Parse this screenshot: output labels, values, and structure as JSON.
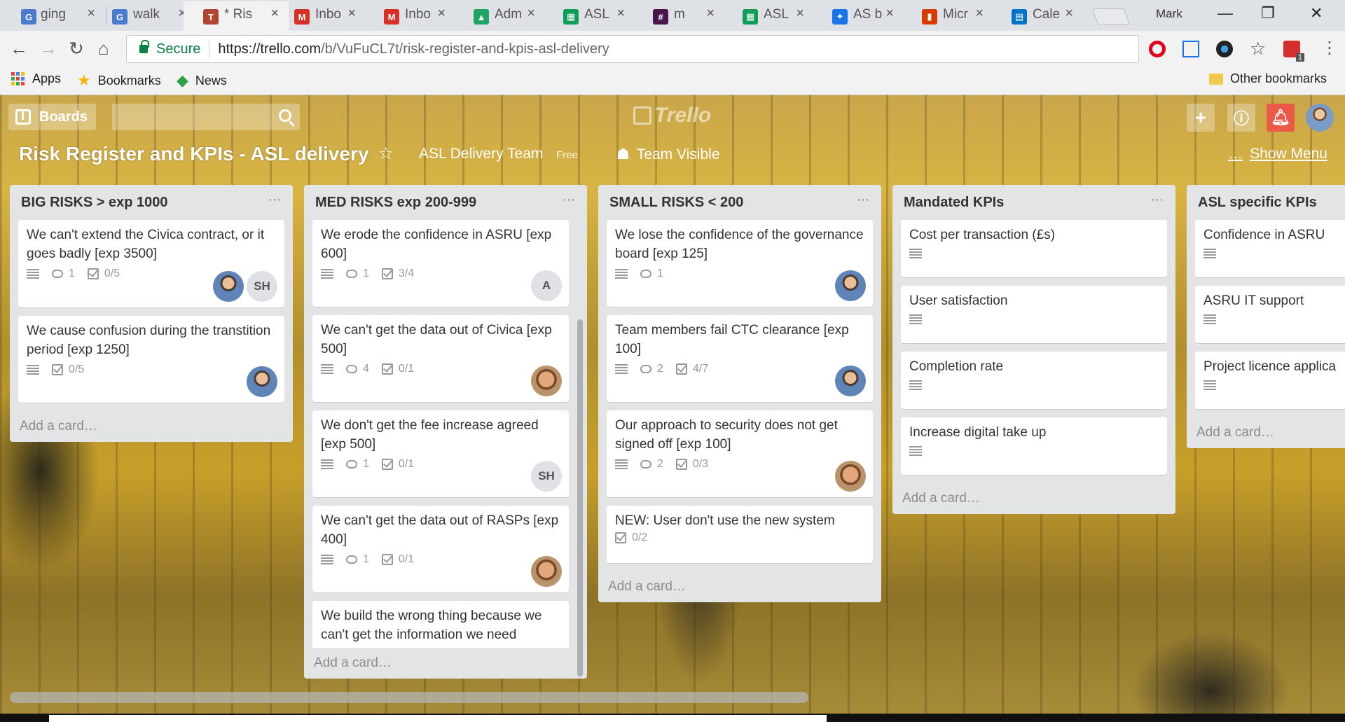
{
  "browser": {
    "tabs": [
      {
        "label": "ging",
        "color": "#4a7bd0",
        "icon": "G"
      },
      {
        "label": "walk",
        "color": "#4a7bd0",
        "icon": "G"
      },
      {
        "label": "* Ris",
        "color": "#b04632",
        "icon": "T",
        "active": true
      },
      {
        "label": "Inbo",
        "color": "#d93025",
        "icon": "M"
      },
      {
        "label": "Inbo",
        "color": "#d93025",
        "icon": "M"
      },
      {
        "label": "Adm",
        "color": "#1fa463",
        "icon": "▲"
      },
      {
        "label": "ASL",
        "color": "#0f9d58",
        "icon": "▦"
      },
      {
        "label": "m",
        "color": "#4a154b",
        "icon": "#"
      },
      {
        "label": "ASL",
        "color": "#0f9d58",
        "icon": "▦"
      },
      {
        "label": "AS b",
        "color": "#1a73e8",
        "icon": "✦"
      },
      {
        "label": "Micr",
        "color": "#d83b01",
        "icon": "▮"
      },
      {
        "label": "Cale",
        "color": "#0072c6",
        "icon": "▤"
      }
    ],
    "user": "Mark",
    "secure_label": "Secure",
    "url_domain": "https://trello.com",
    "url_path": "/b/VuFuCL7t/risk-register-and-kpis-asl-delivery",
    "bookmarks": {
      "apps": "Apps",
      "bookmarks": "Bookmarks",
      "news": "News",
      "other": "Other bookmarks"
    },
    "extension_badge": "1"
  },
  "trello": {
    "boards_label": "Boards",
    "logo": "Trello",
    "board_title": "Risk Register and KPIs - ASL delivery",
    "team": "ASL Delivery Team",
    "team_plan": "Free",
    "visibility": "Team Visible",
    "show_menu": "Show Menu",
    "add_card": "Add a card…",
    "lists": [
      {
        "title": "BIG RISKS > exp 1000",
        "cards": [
          {
            "title": "We can't extend the Civica contract, or it goes badly [exp 3500]",
            "comments": "1",
            "checklist": "0/5",
            "members": [
              "photo",
              "SH"
            ]
          },
          {
            "title": "We cause confusion during the transtition period [exp 1250]",
            "comments": "",
            "checklist": "0/5",
            "members": [
              "photo"
            ]
          }
        ]
      },
      {
        "title": "MED RISKS exp 200-999",
        "cards": [
          {
            "title": "We erode the confidence in ASRU [exp 600]",
            "comments": "1",
            "checklist": "3/4",
            "members": [
              "A"
            ]
          },
          {
            "title": "We can't get the data out of Civica [exp 500]",
            "comments": "4",
            "checklist": "0/1",
            "members": [
              "photo2"
            ]
          },
          {
            "title": "We don't get the fee increase agreed [exp 500]",
            "comments": "1",
            "checklist": "0/1",
            "members": [
              "SH"
            ]
          },
          {
            "title": "We can't get the data out of RASPs [exp 400]",
            "comments": "1",
            "checklist": "0/1",
            "members": [
              "photo2"
            ]
          },
          {
            "title": "We build the wrong thing because we can't get the information we need",
            "comments": "",
            "checklist": "",
            "members": []
          }
        ]
      },
      {
        "title": "SMALL RISKS < 200",
        "cards": [
          {
            "title": "We lose the confidence of the governance board [exp 125]",
            "comments": "1",
            "checklist": "",
            "members": [
              "photo"
            ]
          },
          {
            "title": "Team members fail CTC clearance [exp 100]",
            "comments": "2",
            "checklist": "4/7",
            "members": [
              "photo"
            ]
          },
          {
            "title": "Our approach to security does not get signed off [exp 100]",
            "comments": "2",
            "checklist": "0/3",
            "members": [
              "photo2"
            ]
          },
          {
            "title": "NEW: User don't use the new system",
            "comments": "",
            "checklist": "0/2",
            "members": []
          }
        ]
      },
      {
        "title": "Mandated KPIs",
        "cards": [
          {
            "title": "Cost per transaction (£s)"
          },
          {
            "title": "User satisfaction"
          },
          {
            "title": "Completion rate"
          },
          {
            "title": "Increase digital take up"
          }
        ]
      },
      {
        "title": "ASL specific KPIs",
        "cards": [
          {
            "title": "Confidence in ASRU"
          },
          {
            "title": "ASRU IT support"
          },
          {
            "title": "Project licence applica"
          }
        ]
      }
    ]
  }
}
